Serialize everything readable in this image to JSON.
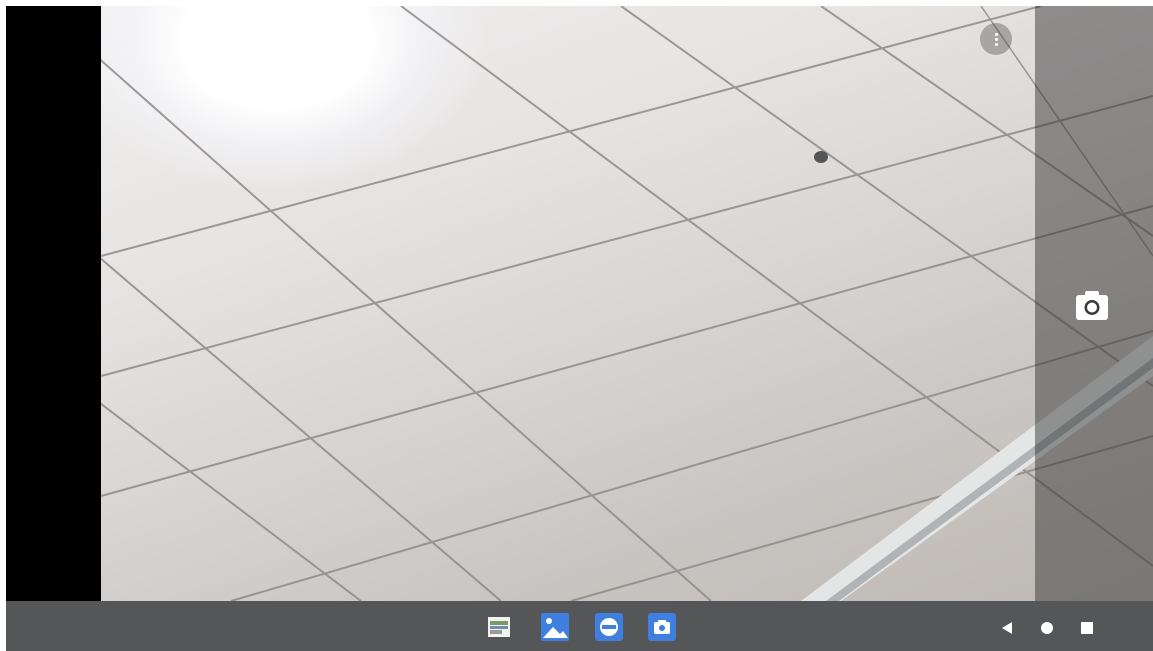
{
  "app": {
    "overflow_menu_icon": "more-vert-icon",
    "shutter_icon": "camera-icon"
  },
  "taskbar": {
    "apps": [
      {
        "name": "files-app",
        "icon": "files-icon"
      },
      {
        "name": "gallery-app",
        "icon": "photos-icon"
      },
      {
        "name": "browser-app",
        "icon": "browser-icon"
      },
      {
        "name": "camera-app",
        "icon": "camera-icon"
      }
    ],
    "nav": [
      {
        "name": "back",
        "icon": "back-triangle-icon"
      },
      {
        "name": "home",
        "icon": "home-circle-icon"
      },
      {
        "name": "recents",
        "icon": "recents-square-icon"
      }
    ]
  },
  "colors": {
    "taskbar_bg": "#555657",
    "icon_blue": "#3f7fe0",
    "overlay": "#282828"
  }
}
